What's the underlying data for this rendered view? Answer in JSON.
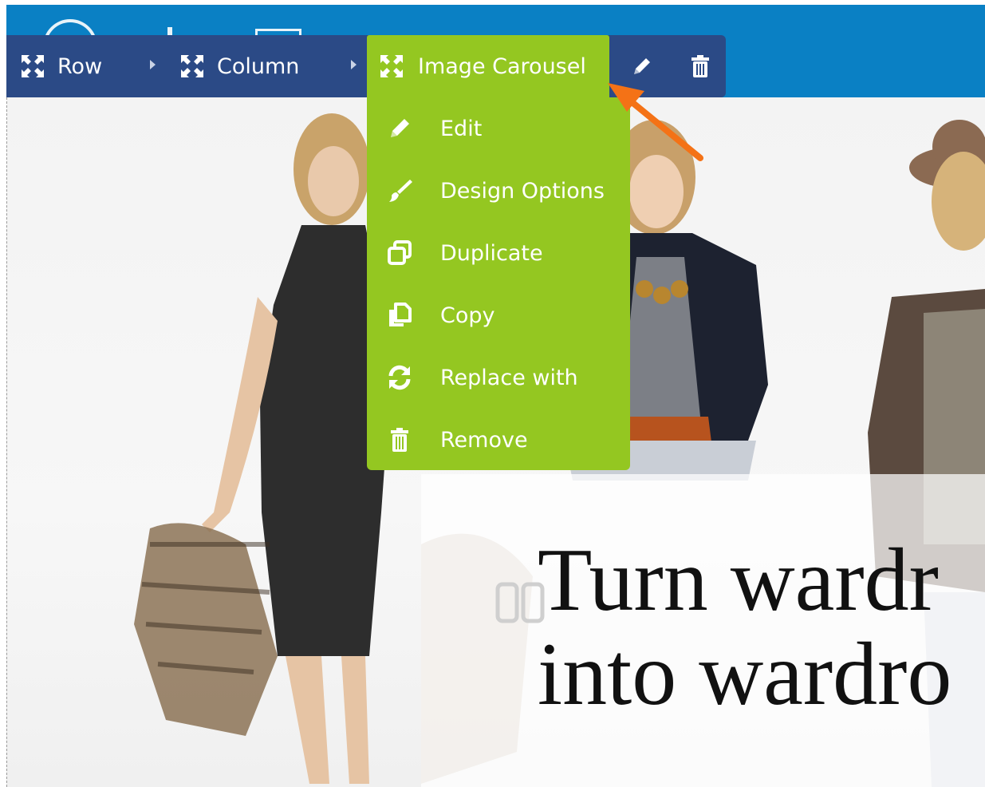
{
  "breadcrumb": {
    "row_label": "Row",
    "column_label": "Column",
    "active_label": "Image Carousel"
  },
  "icons": {
    "row": "move-arrows-icon",
    "column": "move-arrows-icon",
    "active": "move-arrows-icon",
    "edit": "pencil-icon",
    "delete": "trash-icon"
  },
  "menu": {
    "items": [
      {
        "label": "Edit",
        "icon": "pencil-icon"
      },
      {
        "label": "Design Options",
        "icon": "brush-icon"
      },
      {
        "label": "Duplicate",
        "icon": "duplicate-icon"
      },
      {
        "label": "Copy",
        "icon": "copy-icon"
      },
      {
        "label": "Replace with",
        "icon": "refresh-icon"
      },
      {
        "label": "Remove",
        "icon": "trash-icon"
      }
    ]
  },
  "hero": {
    "line1": "Turn wardr",
    "line2": "into wardro"
  },
  "colors": {
    "header_blue": "#0a80c4",
    "controls_navy": "#2b4a86",
    "active_green": "#94c721",
    "annotation_orange": "#f47216"
  }
}
